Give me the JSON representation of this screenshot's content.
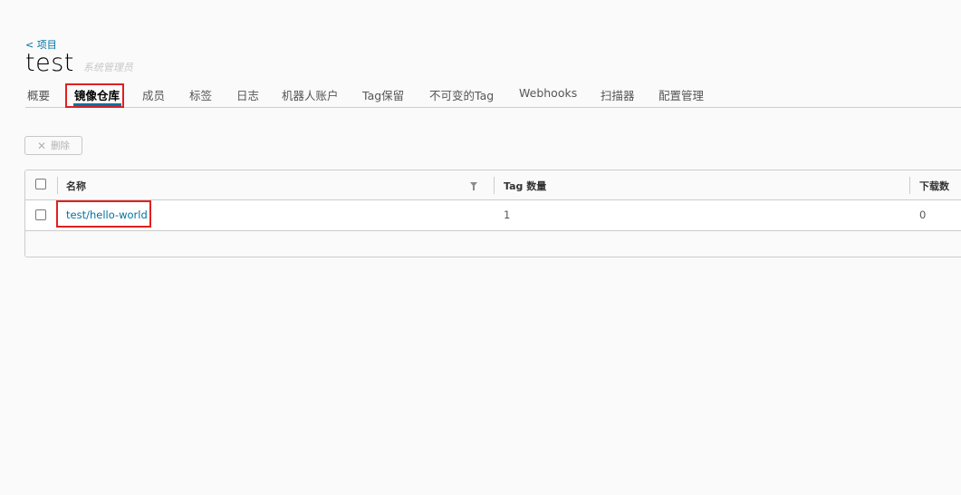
{
  "header": {
    "back_label": "< 项目",
    "project_name": "test",
    "role": "系统管理员"
  },
  "tabs": [
    {
      "label": "概要",
      "active": false
    },
    {
      "label": "镜像仓库",
      "active": true
    },
    {
      "label": "成员",
      "active": false
    },
    {
      "label": "标签",
      "active": false
    },
    {
      "label": "日志",
      "active": false
    },
    {
      "label": "机器人账户",
      "active": false
    },
    {
      "label": "Tag保留",
      "active": false
    },
    {
      "label": "不可变的Tag",
      "active": false
    },
    {
      "label": "Webhooks",
      "active": false
    },
    {
      "label": "扫描器",
      "active": false
    },
    {
      "label": "配置管理",
      "active": false
    }
  ],
  "toolbar": {
    "delete_label": "删除",
    "delete_icon": "close-icon"
  },
  "table": {
    "columns": [
      "名称",
      "Tag 数量",
      "下载数"
    ],
    "rows": [
      {
        "name": "test/hello-world",
        "tag_count": "1",
        "downloads": "0"
      }
    ]
  },
  "colors": {
    "accent": "#0072a3",
    "highlight": "#e02020"
  }
}
